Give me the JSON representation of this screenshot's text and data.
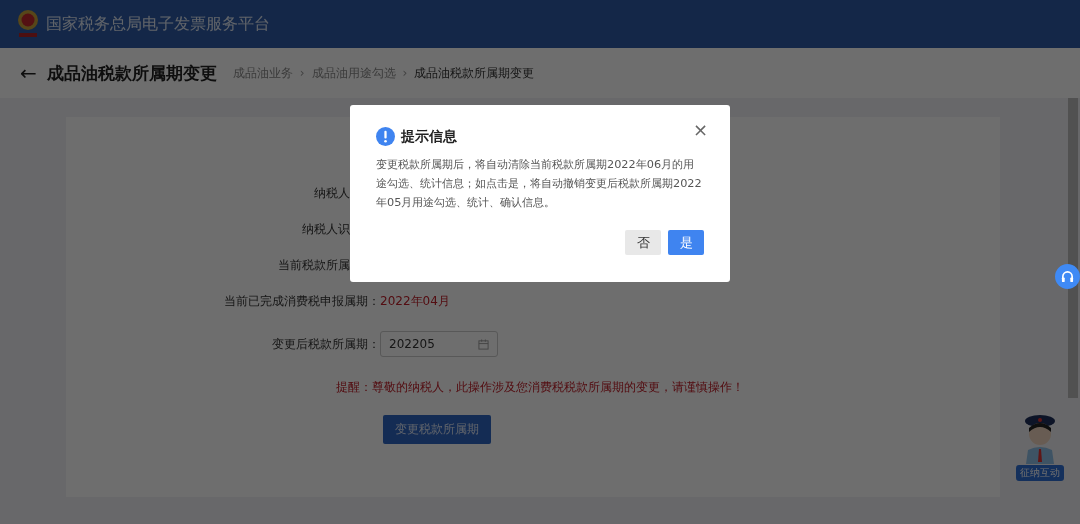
{
  "header": {
    "title": "国家税务总局电子发票服务平台"
  },
  "page": {
    "back": "←",
    "title": "成品油税款所属期变更",
    "breadcrumb": [
      {
        "label": "成品油业务",
        "current": false
      },
      {
        "label": "成品油用途勾选",
        "current": false
      },
      {
        "label": "成品油税款所属期变更",
        "current": true
      }
    ],
    "separator": "›"
  },
  "form": {
    "rows": [
      {
        "kind": "covered",
        "label": "纳税人"
      },
      {
        "kind": "covered",
        "label": "纳税人识"
      },
      {
        "kind": "covered",
        "label": "当前税款所属"
      },
      {
        "kind": "text",
        "label": "当前已完成消费税申报属期：",
        "value": "2022年04月"
      },
      {
        "kind": "date",
        "label": "变更后税款所属期：",
        "value": "202205"
      }
    ],
    "warning": "提醒：尊敬的纳税人，此操作涉及您消费税税款所属期的变更，请谨慎操作！",
    "submit": "变更税款所属期"
  },
  "assistant": {
    "label": "征纳互动"
  },
  "dialog": {
    "title": "提示信息",
    "close": "×",
    "message": "变更税款所属期后，将自动清除当前税款所属期2022年06月的用途勾选、统计信息；如点击是，将自动撤销变更后税款所属期2022年05月用途勾选、统计、确认信息。",
    "buttons": [
      {
        "label": "否",
        "primary": false
      },
      {
        "label": "是",
        "primary": true
      }
    ]
  }
}
